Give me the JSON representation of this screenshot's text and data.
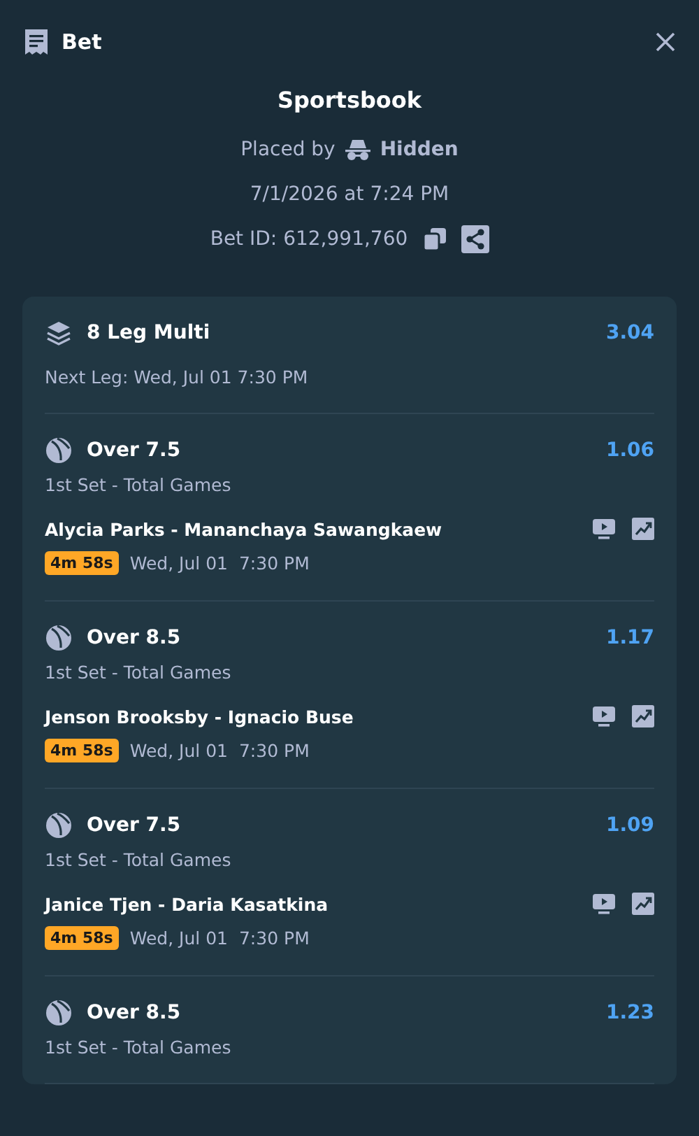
{
  "header": {
    "title": "Bet"
  },
  "summary": {
    "provider": "Sportsbook",
    "placed_by_label": "Placed by",
    "placed_by": "Hidden",
    "placed_at": "7/1/2026 at 7:24 PM",
    "bet_id": "Bet ID: 612,991,760"
  },
  "multi": {
    "title": "8 Leg Multi",
    "odds": "3.04",
    "next_leg": "Next Leg: Wed, Jul 01 7:30 PM"
  },
  "legs": [
    {
      "selection": "Over 7.5",
      "odds": "1.06",
      "market": "1st Set - Total Games",
      "match": "Alycia Parks - Mananchaya Sawangkaew",
      "countdown": "4m 58s",
      "date": "Wed, Jul 01",
      "time": "7:30 PM"
    },
    {
      "selection": "Over 8.5",
      "odds": "1.17",
      "market": "1st Set - Total Games",
      "match": "Jenson Brooksby - Ignacio Buse",
      "countdown": "4m 58s",
      "date": "Wed, Jul 01",
      "time": "7:30 PM"
    },
    {
      "selection": "Over 7.5",
      "odds": "1.09",
      "market": "1st Set - Total Games",
      "match": "Janice Tjen - Daria Kasatkina",
      "countdown": "4m 58s",
      "date": "Wed, Jul 01",
      "time": "7:30 PM"
    },
    {
      "selection": "Over 8.5",
      "odds": "1.23",
      "market": "1st Set - Total Games"
    }
  ]
}
